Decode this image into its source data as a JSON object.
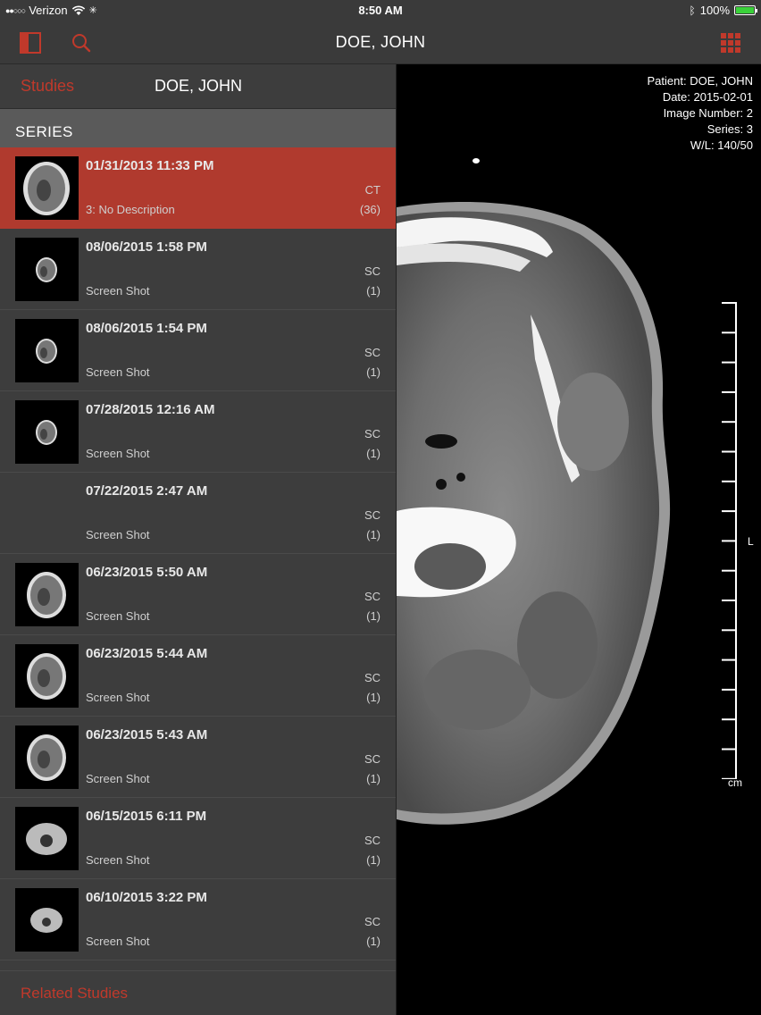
{
  "status_bar": {
    "carrier": "Verizon",
    "time": "8:50 AM",
    "battery": "100%",
    "battery_level": 1.0
  },
  "nav": {
    "title": "DOE, JOHN",
    "icons": [
      "sidebar-toggle-icon",
      "search-icon",
      "grid-icon"
    ],
    "accent": "#c0392b"
  },
  "panel": {
    "studies_label": "Studies",
    "patient_name": "DOE, JOHN",
    "series_header": "SERIES",
    "related_label": "Related Studies",
    "selected_color": "#b03a2e",
    "rows": [
      {
        "date": "01/31/2013 11:33 PM",
        "modality": "CT",
        "description": "3: No Description",
        "count": "(36)",
        "selected": true
      },
      {
        "date": "08/06/2015 1:58 PM",
        "modality": "SC",
        "description": "Screen Shot",
        "count": "(1)"
      },
      {
        "date": "08/06/2015 1:54 PM",
        "modality": "SC",
        "description": "Screen Shot",
        "count": "(1)"
      },
      {
        "date": "07/28/2015 12:16 AM",
        "modality": "SC",
        "description": "Screen Shot",
        "count": "(1)"
      },
      {
        "date": "07/22/2015 2:47 AM",
        "modality": "SC",
        "description": "Screen Shot",
        "count": "(1)"
      },
      {
        "date": "06/23/2015 5:50 AM",
        "modality": "SC",
        "description": "Screen Shot",
        "count": "(1)"
      },
      {
        "date": "06/23/2015 5:44 AM",
        "modality": "SC",
        "description": "Screen Shot",
        "count": "(1)"
      },
      {
        "date": "06/23/2015 5:43 AM",
        "modality": "SC",
        "description": "Screen Shot",
        "count": "(1)"
      },
      {
        "date": "06/15/2015 6:11 PM",
        "modality": "SC",
        "description": "Screen Shot",
        "count": "(1)"
      },
      {
        "date": "06/10/2015 3:22 PM",
        "modality": "SC",
        "description": "Screen Shot",
        "count": "(1)"
      }
    ]
  },
  "viewer": {
    "patient_line": "Patient: DOE, JOHN",
    "date_line": "Date: 2015-02-01",
    "image_line": "Image Number: 2",
    "series_line": "Series: 3",
    "wl_line": "W/L: 140/50",
    "ruler_unit": "cm",
    "orientation_label": "L"
  }
}
